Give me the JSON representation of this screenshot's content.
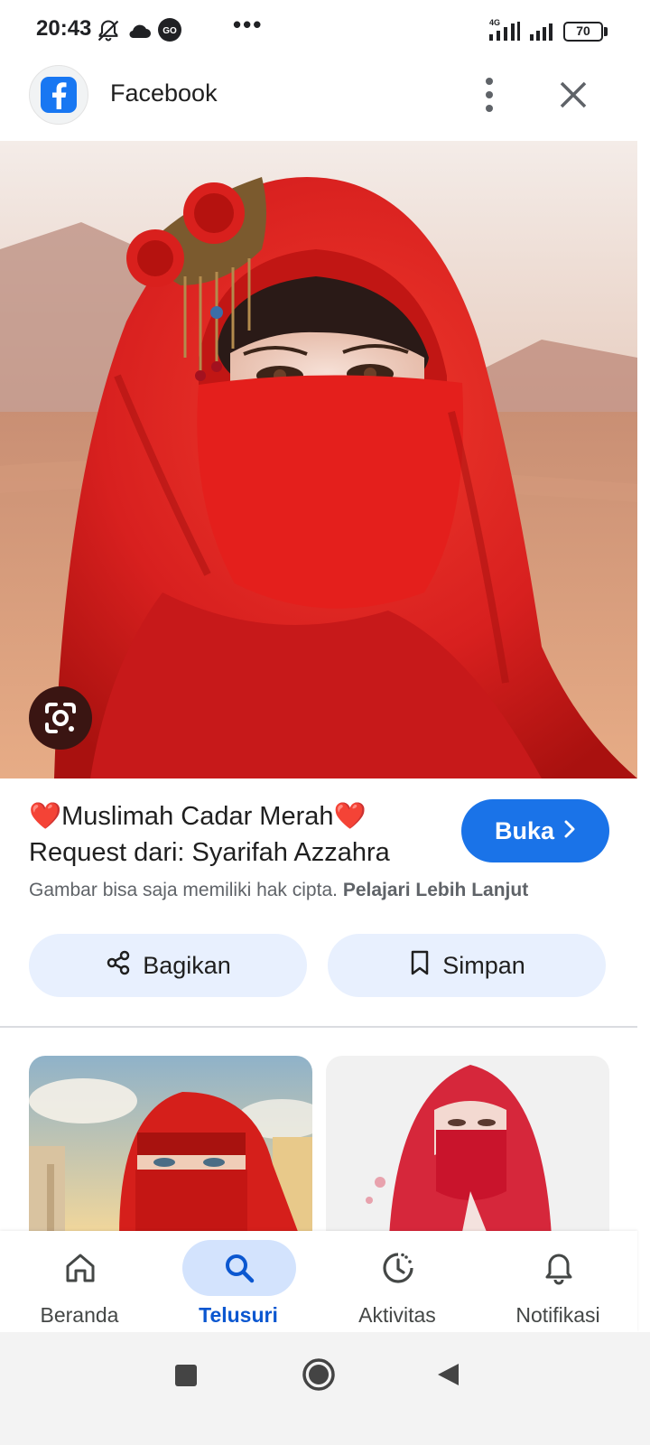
{
  "status_bar": {
    "time": "20:43",
    "dots": "•••",
    "network": "4G",
    "battery": "70",
    "icons": [
      "notifications-off-icon",
      "cloud-icon",
      "go-badge-icon",
      "signal-icon",
      "signal-icon",
      "battery-icon"
    ]
  },
  "header": {
    "app_name": "Facebook",
    "logo_icon": "facebook-logo",
    "more_icon": "more-vert-icon",
    "close_icon": "close-icon"
  },
  "result": {
    "title_line1": "❤️Muslimah Cadar Merah❤️",
    "title_line2": "Request dari: Syarifah Azzahra",
    "open_label": "Buka",
    "copyright_text": "Gambar bisa saja memiliki hak cipta.",
    "learn_more": "Pelajari Lebih Lanjut"
  },
  "actions": {
    "share_label": "Bagikan",
    "save_label": "Simpan"
  },
  "bottom_nav": {
    "items": [
      {
        "label": "Beranda",
        "icon": "home-icon",
        "active": false
      },
      {
        "label": "Telusuri",
        "icon": "search-icon",
        "active": true
      },
      {
        "label": "Aktivitas",
        "icon": "history-icon",
        "active": false
      },
      {
        "label": "Notifikasi",
        "icon": "bell-icon",
        "active": false
      }
    ]
  },
  "colors": {
    "accent": "#1a73e8",
    "active_nav": "#0b57d0",
    "active_pill": "#d3e3fd",
    "action_button_bg": "#e8f0fe",
    "image_red": "#d8201f"
  }
}
